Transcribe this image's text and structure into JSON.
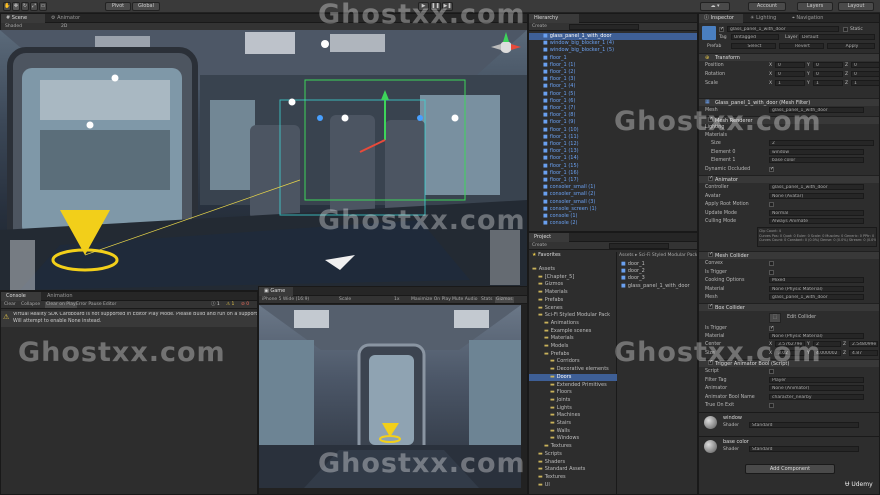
{
  "toolbar": {
    "pivot": "Pivot",
    "global": "Global",
    "account": "Account",
    "layers": "Layers",
    "layout": "Layout"
  },
  "scene": {
    "tabs": [
      "Scene",
      "Animator"
    ],
    "shaded": "Shaded",
    "mode_2d": "2D"
  },
  "hierarchy": {
    "tab": "Hierarchy",
    "create": "Create",
    "items": [
      {
        "label": "glass_panel_1_with_door",
        "selected": true
      },
      {
        "label": "window_big_blocker_1 (4)"
      },
      {
        "label": "window_big_blocker_1 (5)"
      },
      {
        "label": "floor_1"
      },
      {
        "label": "floor_1 (1)"
      },
      {
        "label": "floor_1 (2)"
      },
      {
        "label": "floor_1 (3)"
      },
      {
        "label": "floor_1 (4)"
      },
      {
        "label": "floor_1 (5)"
      },
      {
        "label": "floor_1 (6)"
      },
      {
        "label": "floor_1 (7)"
      },
      {
        "label": "floor_1 (8)"
      },
      {
        "label": "floor_1 (9)"
      },
      {
        "label": "floor_1 (10)"
      },
      {
        "label": "floor_1 (11)"
      },
      {
        "label": "floor_1 (12)"
      },
      {
        "label": "floor_1 (13)"
      },
      {
        "label": "floor_1 (14)"
      },
      {
        "label": "floor_1 (15)"
      },
      {
        "label": "floor_1 (16)"
      },
      {
        "label": "floor_1 (17)"
      },
      {
        "label": "consoler_small (1)"
      },
      {
        "label": "consoler_small (2)"
      },
      {
        "label": "consoler_small (3)"
      },
      {
        "label": "console_screen (1)"
      },
      {
        "label": "console (1)"
      },
      {
        "label": "console (2)"
      }
    ]
  },
  "project": {
    "tab": "Project",
    "create": "Create",
    "favorites": "Favorites",
    "breadcrumb": "Assets ▸ Sci-Fi Styled Modular Pack",
    "tree": [
      {
        "label": "Assets",
        "indent": 0
      },
      {
        "label": "[Chapter_5]",
        "indent": 1
      },
      {
        "label": "Gizmos",
        "indent": 1
      },
      {
        "label": "Materials",
        "indent": 1
      },
      {
        "label": "Prefabs",
        "indent": 1
      },
      {
        "label": "Scenes",
        "indent": 1
      },
      {
        "label": "Sci-Fi Styled Modular Pack",
        "indent": 1
      },
      {
        "label": "Animations",
        "indent": 2
      },
      {
        "label": "Example scenes",
        "indent": 2
      },
      {
        "label": "Materials",
        "indent": 2
      },
      {
        "label": "Models",
        "indent": 2
      },
      {
        "label": "Prefabs",
        "indent": 2
      },
      {
        "label": "Corridors",
        "indent": 3
      },
      {
        "label": "Decorative elements",
        "indent": 3
      },
      {
        "label": "Doors",
        "indent": 3,
        "selected": true
      },
      {
        "label": "Extended Primitives",
        "indent": 3
      },
      {
        "label": "Floors",
        "indent": 3
      },
      {
        "label": "Joints",
        "indent": 3
      },
      {
        "label": "Lights",
        "indent": 3
      },
      {
        "label": "Machines",
        "indent": 3
      },
      {
        "label": "Stairs",
        "indent": 3
      },
      {
        "label": "Walls",
        "indent": 3
      },
      {
        "label": "Windows",
        "indent": 3
      },
      {
        "label": "Textures",
        "indent": 2
      },
      {
        "label": "Scripts",
        "indent": 1
      },
      {
        "label": "Shaders",
        "indent": 1
      },
      {
        "label": "Standard Assets",
        "indent": 1
      },
      {
        "label": "Textures",
        "indent": 1
      },
      {
        "label": "UI",
        "indent": 1
      }
    ],
    "files": [
      "door_1",
      "door_2",
      "door_3",
      "glass_panel_1_with_door"
    ]
  },
  "console": {
    "tabs": [
      "Console",
      "Animation"
    ],
    "buttons": [
      "Clear",
      "Collapse",
      "Clear on Play",
      "Error Pause",
      "Editor"
    ],
    "message_line1": "Virtual Reality SDK Cardboard is not supported in Editor Play Mode. Please Build and run on a supporte",
    "message_line2": "Will attempt to enable None instead."
  },
  "game": {
    "tab": "Game",
    "resolution": "iPhone 5 Wide (16:9)",
    "scale": "Scale",
    "scale_value": "1x",
    "buttons": [
      "Maximize On Play",
      "Mute Audio",
      "Stats",
      "Gizmos"
    ]
  },
  "inspector": {
    "tabs": [
      "Inspector",
      "Lighting",
      "Navigation"
    ],
    "object_name": "glass_panel_1_with_door",
    "static": "Static",
    "tag_label": "Tag",
    "tag_value": "Untagged",
    "layer_label": "Layer",
    "layer_value": "Default",
    "prefab_label": "Prefab",
    "prefab_buttons": [
      "Select",
      "Revert",
      "Apply"
    ],
    "transform": {
      "title": "Transform",
      "rows": [
        {
          "label": "Position",
          "x": "0",
          "y": "0",
          "z": "0"
        },
        {
          "label": "Rotation",
          "x": "0",
          "y": "0",
          "z": "0"
        },
        {
          "label": "Scale",
          "x": "1",
          "y": "1",
          "z": "1"
        }
      ]
    },
    "mesh_filter": {
      "title": "Glass_panel_1_with_door (Mesh Filter)",
      "mesh_label": "Mesh",
      "mesh_value": "glass_panel_1_with_door"
    },
    "mesh_renderer": {
      "title": "Mesh Renderer",
      "lighting": "Lighting",
      "materials": "Materials",
      "size_label": "Size",
      "size_value": "2",
      "element0_label": "Element 0",
      "element0_value": "window",
      "element1_label": "Element 1",
      "element1_value": "base color",
      "dynamic_occluded": "Dynamic Occluded"
    },
    "animator": {
      "title": "Animator",
      "rows": [
        {
          "label": "Controller",
          "value": "glass_panel_1_with_door"
        },
        {
          "label": "Avatar",
          "value": "None (Avatar)"
        },
        {
          "label": "Apply Root Motion",
          "value": ""
        },
        {
          "label": "Update Mode",
          "value": "Normal"
        },
        {
          "label": "Culling Mode",
          "value": "Always Animate"
        }
      ],
      "info_line1": "Clip Count: 4",
      "info_line2": "Curves Pos: 0 Quat: 0 Euler: 0 Scale: 0 Muscles: 0 Generic: 0 PPtr: 0",
      "info_line3": "Curves Count: 0 Constant: 0 (0.0%) Dense: 0 (0.0%) Stream: 0 (0.0%)"
    },
    "mesh_collider": {
      "title": "Mesh Collider",
      "rows": [
        {
          "label": "Convex",
          "value": ""
        },
        {
          "label": "Is Trigger",
          "value": ""
        },
        {
          "label": "Cooking Options",
          "value": "Mixed"
        },
        {
          "label": "Material",
          "value": "None (Physic Material)"
        },
        {
          "label": "Mesh",
          "value": "glass_panel_1_with_door"
        }
      ]
    },
    "box_collider": {
      "title": "Box Collider",
      "edit_collider": "Edit Collider",
      "is_trigger": "Is Trigger",
      "material_label": "Material",
      "material_value": "None (Physic Material)",
      "center_label": "Center",
      "center": {
        "x": "3.576279e",
        "y": "2",
        "z": "2.548099e"
      },
      "size_label": "Size",
      "size": {
        "x": "3.02",
        "y": "4.000002",
        "z": "4.87"
      }
    },
    "trigger_script": {
      "title": "Trigger Animator Bool (Script)",
      "rows": [
        {
          "label": "Script",
          "value": ""
        },
        {
          "label": "Filter Tag",
          "value": "Player"
        },
        {
          "label": "Animator",
          "value": "None (Animator)"
        },
        {
          "label": "Animator Bool Name",
          "value": "character_nearby"
        },
        {
          "label": "True On Exit",
          "value": ""
        }
      ]
    },
    "materials_list": [
      {
        "name": "window",
        "shader_label": "Shader",
        "shader": "Standard"
      },
      {
        "name": "base color",
        "shader_label": "Shader",
        "shader": "Standard"
      }
    ],
    "add_component": "Add Component"
  },
  "watermark": {
    "text": "Ghostxx.com",
    "brand": "Udemy"
  },
  "colors": {
    "accent_selection": "#3e5f96",
    "gizmo_yellow": "#f2cf1a",
    "gizmo_green": "#3dd45a"
  }
}
